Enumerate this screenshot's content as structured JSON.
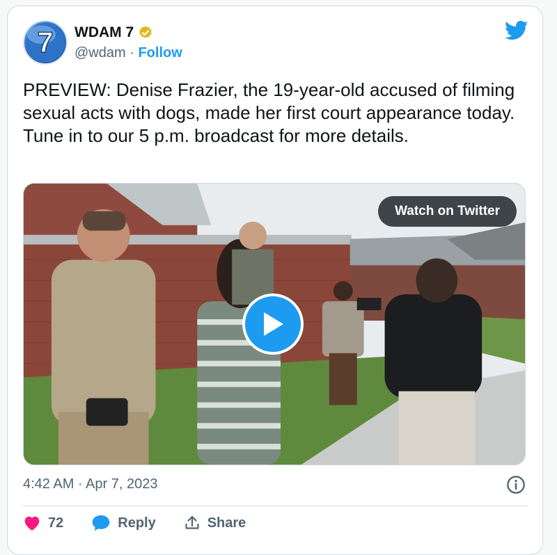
{
  "account": {
    "display_name": "WDAM 7",
    "handle": "@wdam",
    "separator": "·",
    "follow_label": "Follow",
    "avatar_text": "7"
  },
  "tweet": {
    "text": "PREVIEW: Denise Frazier, the 19-year-old accused of filming sexual acts with dogs, made her first court appearance today. Tune in to our 5 p.m. broadcast for more details.",
    "timestamp": "4:42 AM · Apr 7, 2023"
  },
  "media": {
    "watch_label": "Watch on Twitter"
  },
  "actions": {
    "like_count": "72",
    "reply_label": "Reply",
    "share_label": "Share"
  },
  "colors": {
    "accent": "#1d9bf0",
    "like": "#f91880",
    "verified": "#e2b719"
  },
  "icons": [
    "twitter-logo-icon",
    "verified-badge-icon",
    "play-icon",
    "info-icon",
    "heart-icon",
    "reply-bubble-icon",
    "share-icon"
  ]
}
